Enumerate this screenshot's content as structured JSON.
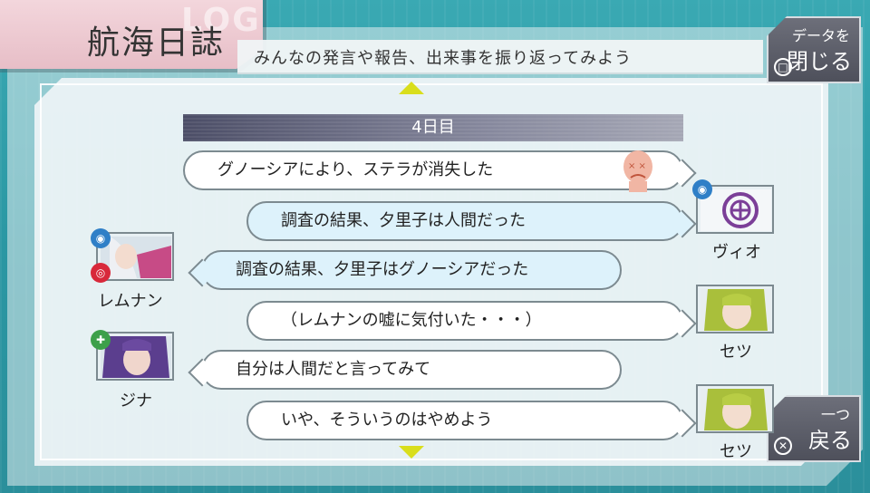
{
  "header": {
    "title": "航海日誌",
    "log_watermark": "LOG",
    "subtitle": "みんなの発言や報告、出来事を振り返ってみよう"
  },
  "close_button": {
    "small": "データを",
    "big": "閉じる",
    "icon": "square-icon"
  },
  "back_button": {
    "small": "一つ",
    "big": "戻る",
    "icon": "cross-icon"
  },
  "day_label": "4日目",
  "entries": [
    {
      "text": "グノーシアにより、ステラが消失した",
      "speaker": "",
      "side": "right",
      "style": "white",
      "icon": "vanished-face-icon"
    },
    {
      "text": "調査の結果、夕里子は人間だった",
      "speaker": "ヴィオ",
      "side": "right",
      "style": "blue",
      "icon": "engineer-role-icon"
    },
    {
      "text": "調査の結果、夕里子はグノーシアだった",
      "speaker": "レムナン",
      "side": "left",
      "style": "blue",
      "icon": "engineer-role-icon"
    },
    {
      "text": "（レムナンの嘘に気付いた・・・）",
      "speaker": "セツ",
      "side": "right",
      "style": "white",
      "icon": ""
    },
    {
      "text": "自分は人間だと言ってみて",
      "speaker": "ジナ",
      "side": "left",
      "style": "white",
      "icon": "doctor-role-icon"
    },
    {
      "text": "いや、そういうのはやめよう",
      "speaker": "セツ",
      "side": "right",
      "style": "white",
      "icon": ""
    }
  ],
  "colors": {
    "accent_yellow": "#d9de1c",
    "engineer_blue": "#2f7fc7",
    "guardian_red": "#d8283a",
    "doctor_green": "#3da04a",
    "header_pink": "#f3d6dc"
  }
}
